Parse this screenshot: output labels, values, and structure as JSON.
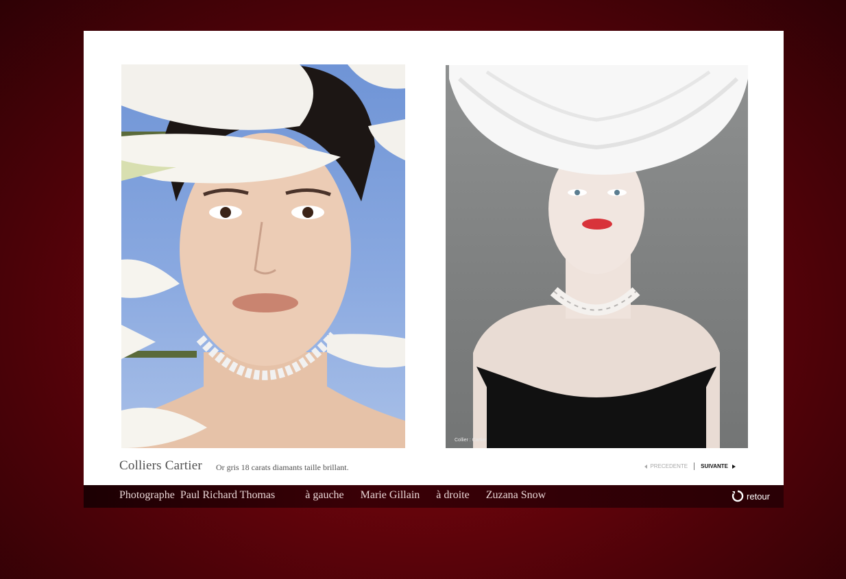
{
  "caption": {
    "title": "Colliers Cartier",
    "detail": "Or gris 18 carats diamants taille brillant."
  },
  "photos": {
    "right_credit": "Collier : Cartier"
  },
  "pager": {
    "previous": "PRECEDENTE",
    "next": "SUIVANTE"
  },
  "credits": {
    "photographer_label": "Photographe",
    "photographer_name": "Paul Richard Thomas",
    "left_label": "à  gauche",
    "left_name": "Marie Gillain",
    "right_label": "à droite",
    "right_name": "Zuzana Snow"
  },
  "nav": {
    "back": "retour"
  },
  "icons": {
    "previous": "arrow-left-icon",
    "next": "arrow-right-icon",
    "back": "reload-circle-icon"
  },
  "colors": {
    "background": "#6c040c",
    "panel": "#ffffff",
    "bar": "#2a0005"
  }
}
